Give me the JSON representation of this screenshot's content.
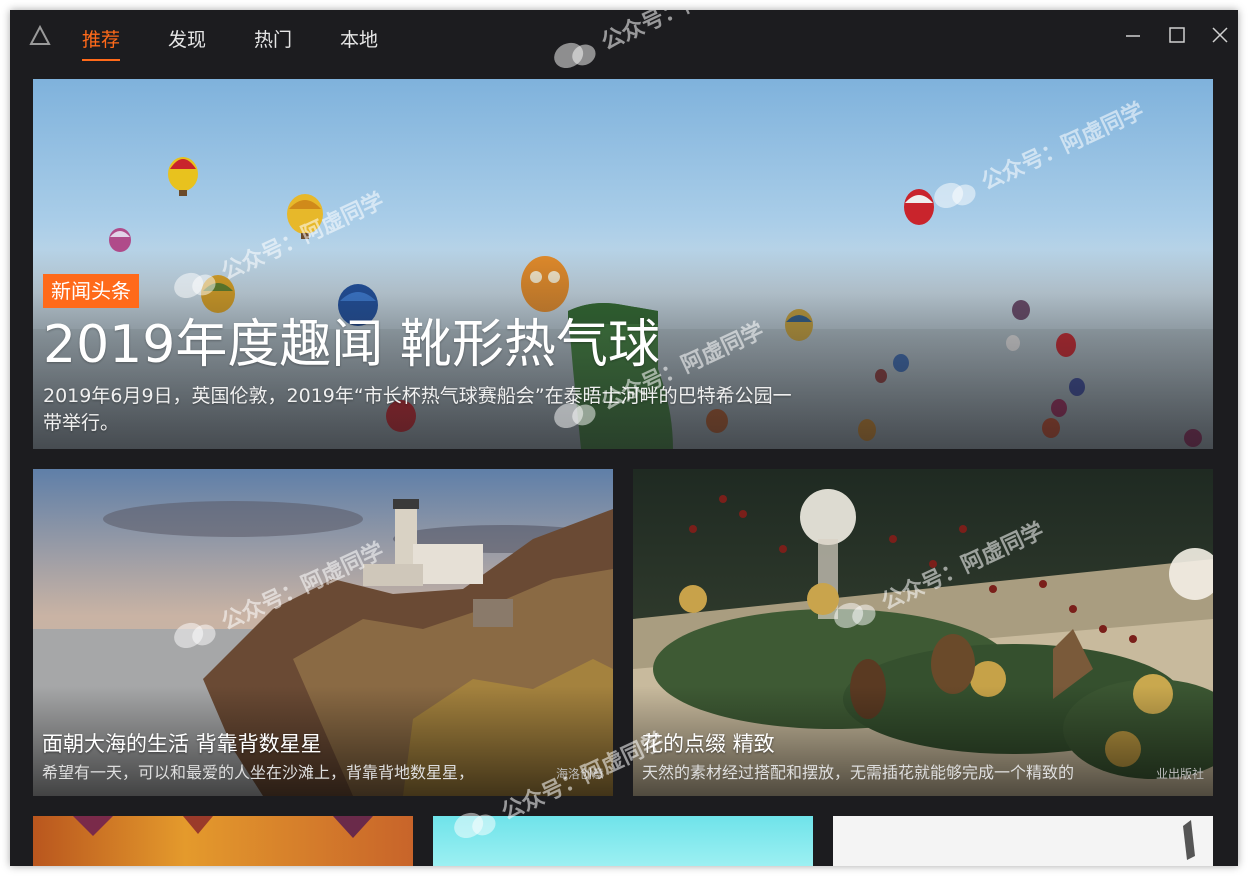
{
  "nav": {
    "tabs": [
      {
        "label": "推荐",
        "active": true
      },
      {
        "label": "发现",
        "active": false
      },
      {
        "label": "热门",
        "active": false
      },
      {
        "label": "本地",
        "active": false
      }
    ]
  },
  "window_controls": [
    "minimize-icon",
    "maximize-icon",
    "close-icon"
  ],
  "hero": {
    "badge": "新闻头条",
    "title": "2019年度趣闻 靴形热气球",
    "description": "2019年6月9日，英国伦敦，2019年“市长杯热气球赛船会”在泰晤士河畔的巴特希公园一带举行。"
  },
  "cards": [
    {
      "title": "面朝大海的生活 背靠背数星星",
      "description": "希望有一天，可以和最爱的人坐在沙滩上，背靠背地数星星，",
      "source": "海洛创意"
    },
    {
      "title": "花的点缀 精致",
      "description": "天然的素材经过搭配和摆放，无需插花就能够完成一个精致的",
      "source": "业出版社"
    }
  ],
  "watermark": "公众号：阿虚同学",
  "colors": {
    "accent": "#ff6a1a",
    "window_bg": "#1c1c1f",
    "text_primary": "#ffffff"
  }
}
